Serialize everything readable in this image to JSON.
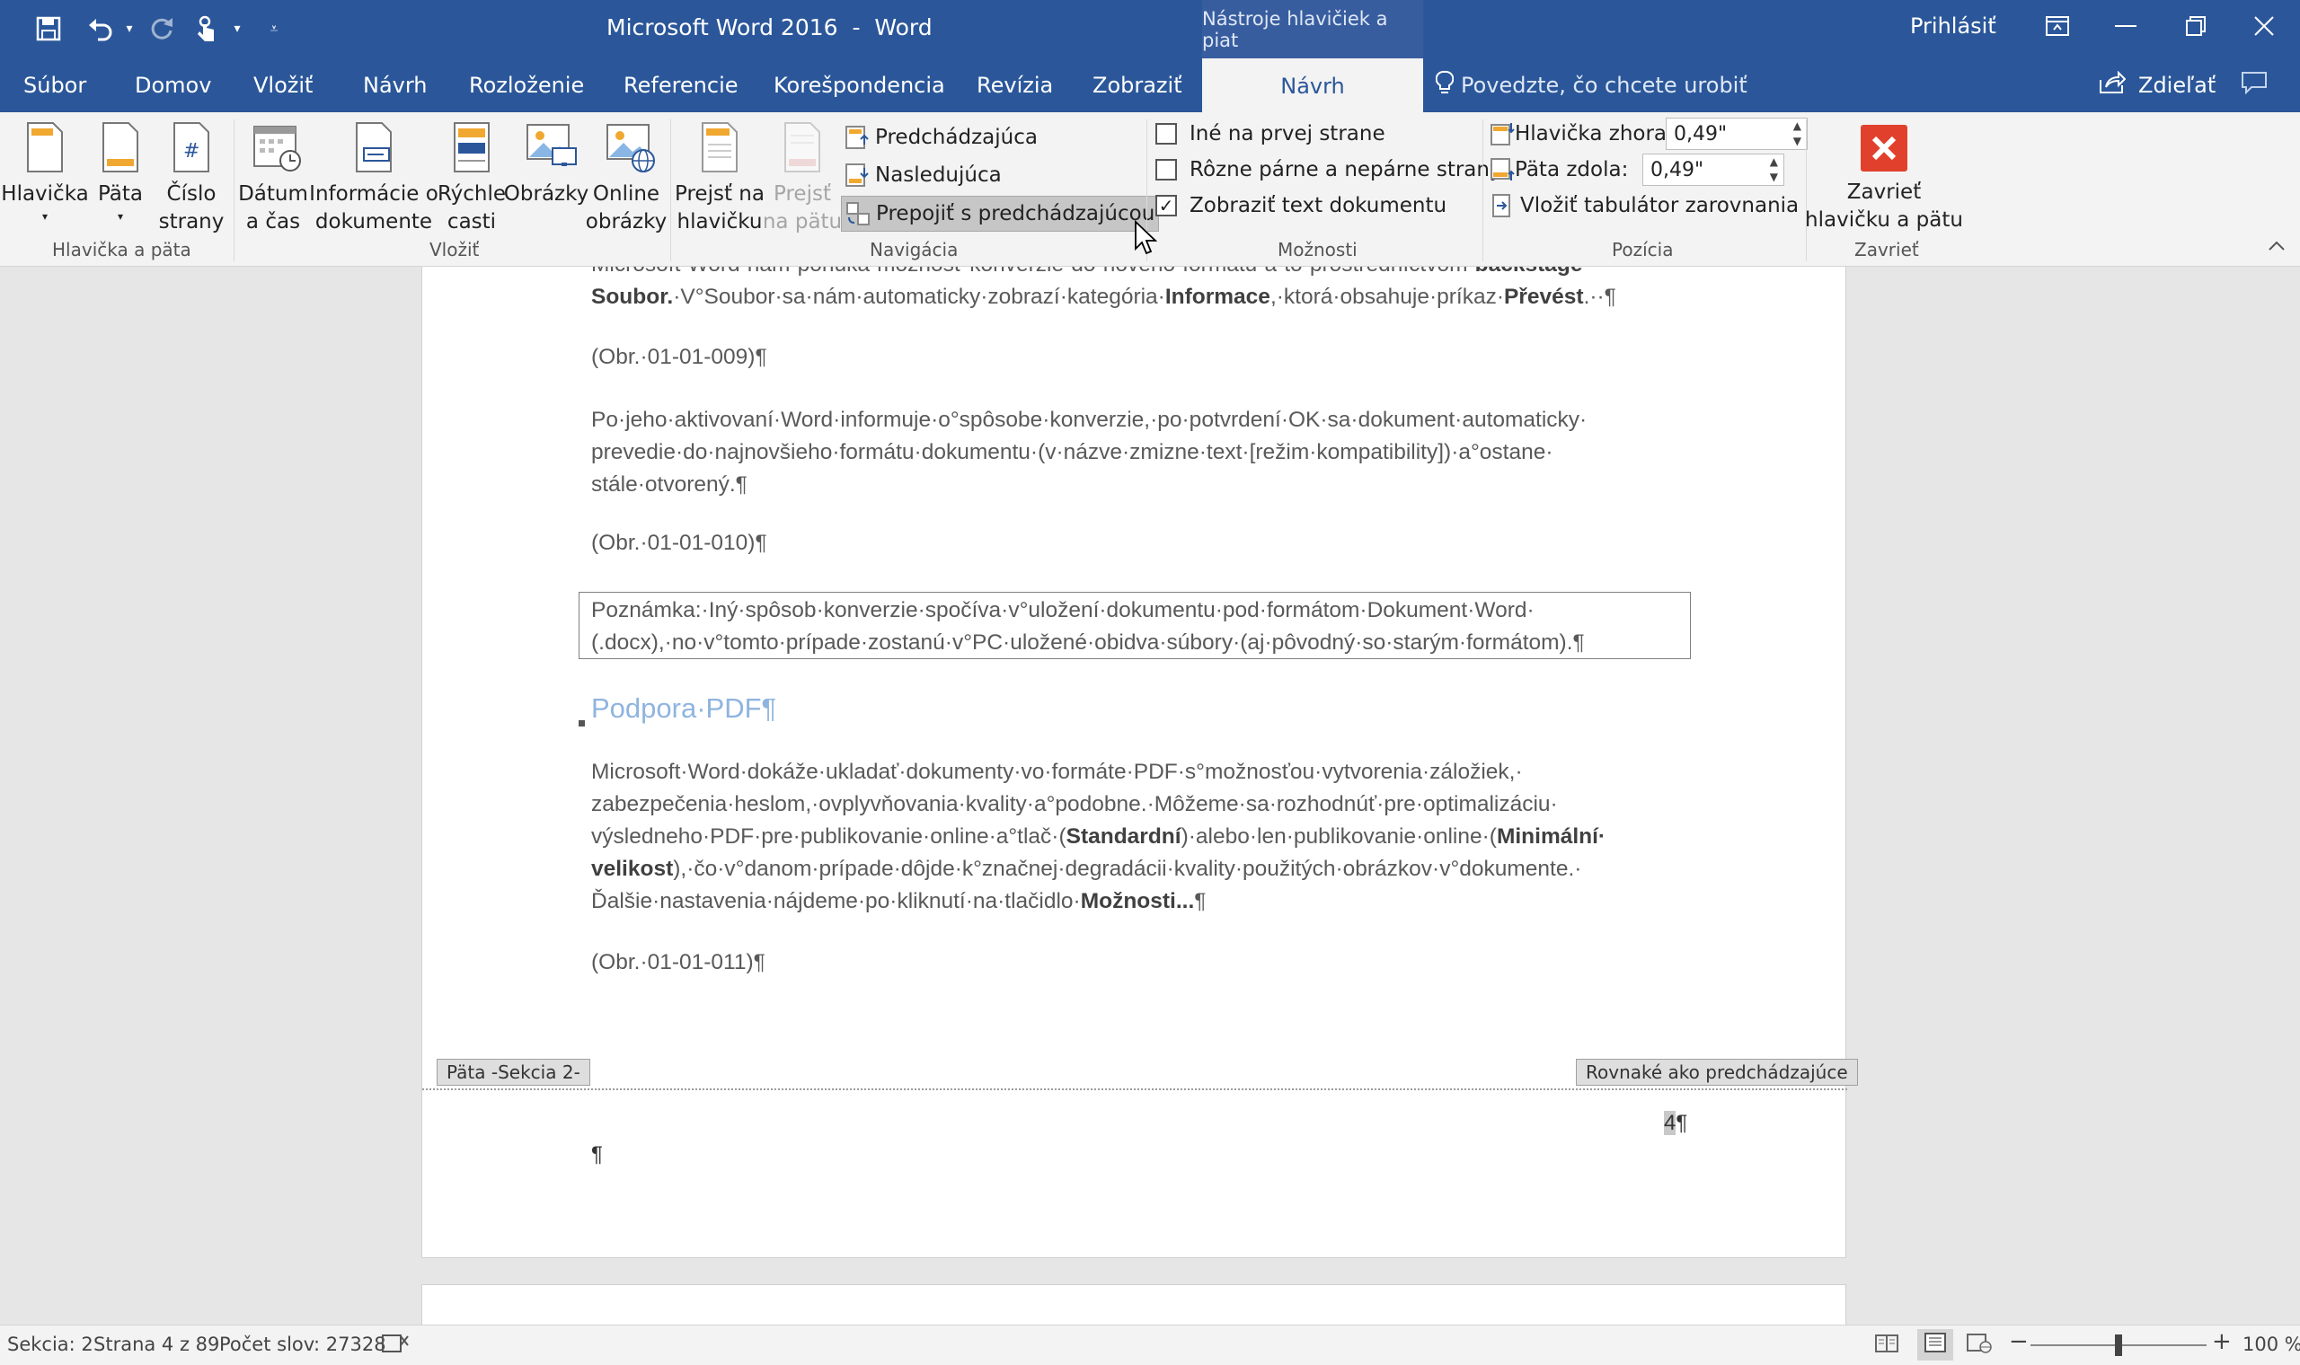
{
  "window": {
    "title": "Microsoft Word 2016  -  Word",
    "context_tools": "Nástroje hlavičiek a piat",
    "signin": "Prihlásiť"
  },
  "tabs": {
    "items": [
      "Súbor",
      "Domov",
      "Vložiť",
      "Návrh",
      "Rozloženie",
      "Referencie",
      "Korešpondencia",
      "Revízia",
      "Zobraziť"
    ],
    "active_context": "Návrh",
    "tell_me": "Povedzte, čo chcete urobiť",
    "share": "Zdieľať"
  },
  "ribbon": {
    "groups": {
      "header_footer": "Hlavička a päta",
      "insert": "Vložiť",
      "navigation": "Navigácia",
      "options": "Možnosti",
      "position": "Pozícia",
      "close": "Zavrieť"
    },
    "buttons": {
      "header": "Hlavička",
      "footer": "Päta",
      "page_number": "Číslo\nstrany",
      "date_time": "Dátum\na čas",
      "doc_info": "Informácie o\ndokumente",
      "quick_parts": "Rýchle\ncasti",
      "pictures": "Obrázky",
      "online_pictures": "Online\nobrázky",
      "goto_header": "Prejsť na\nhlavičku",
      "goto_footer": "Prejsť\nna pätu",
      "previous": "Predchádzajúca",
      "next": "Nasledujúca",
      "link_previous": "Prepojiť s predchádzajúcou",
      "close_hf": "Zavrieť\nhlavičku a pätu"
    },
    "options": {
      "different_first": "Iné na prvej strane",
      "odd_even": "Rôzne párne a nepárne strany",
      "show_doc_text": "Zobraziť text dokumentu",
      "show_doc_text_checked": true
    },
    "position": {
      "header_top_label": "Hlavička zhora:",
      "header_top_value": "0,49\"",
      "footer_bottom_label": "Päta zdola:",
      "footer_bottom_value": "0,49\"",
      "insert_tab": "Vložiť tabulátor zarovnania"
    }
  },
  "document": {
    "p0_line1_a": "Microsoft·Word·nám·ponúka·možnosť·konverzie·do·nového·formátu·a·to·prostredníctvom·",
    "p0_line1_b": "backstage·",
    "p0_line2_a": "Soubor.",
    "p0_line2_b": "·V°Soubor·sa·nám·automaticky·zobrazí·kategória·",
    "p0_line2_c": "Informace",
    "p0_line2_d": ",·ktorá·obsahuje·príkaz·",
    "p0_line2_e": "Převést",
    "p0_line2_f": ".··¶",
    "fig1": "(Obr.·01-01-009)¶",
    "p1_line1": "Po·jeho·aktivovaní·Word·informuje·o°spôsobe·konverzie,·po·potvrdení·OK·sa·dokument·automaticky·",
    "p1_line2": "prevedie·do·najnovšieho·formátu·dokumentu·(v·názve·zmizne·text·[režim·kompatibility])·a°ostane·",
    "p1_line3": "stále·otvorený.¶",
    "fig2": "(Obr.·01-01-010)¶",
    "note_line1": "Poznámka:·Iný·spôsob·konverzie·spočíva·v°uložení·dokumentu·pod·formátom·Dokument·Word·",
    "note_line2": "(.docx),·no·v°tomto·prípade·zostanú·v°PC·uložené·obidva·súbory·(aj·pôvodný·so·starým·formátom).¶",
    "heading": "Podpora·PDF¶",
    "p2_line1": "Microsoft·Word·dokáže·ukladať·dokumenty·vo·formáte·PDF·s°možnosťou·vytvorenia·záložiek,·",
    "p2_line2": "zabezpečenia·heslom,·ovplyvňovania·kvality·a°podobne.·Môžeme·sa·rozhodnúť·pre·optimalizáciu·",
    "p2_line3_a": "výsledneho·PDF·pre·publikovanie·online·a°tlač·(",
    "p2_line3_b": "Standardní",
    "p2_line3_c": ")·alebo·len·publikovanie·online·(",
    "p2_line3_d": "Minimální·",
    "p2_line4_a": "velikost",
    "p2_line4_b": "),·čo·v°danom·prípade·dôjde·k°značnej·degradácii·kvality·použitých·obrázkov·v°dokumente.·",
    "p2_line5_a": "Ďalšie·nastavenia·nájdeme·po·kliknutí·na·tlačidlo·",
    "p2_line5_b": "Možnosti...",
    "p2_line5_c": "¶",
    "fig3": "(Obr.·01-01-011)¶",
    "footer_tag": "Päta -Sekcia 2-",
    "same_as_prev": "Rovnaké ako predchádzajúce",
    "page_num_digit": "4",
    "page_num_mark": "¶",
    "pilcrow": "¶"
  },
  "status": {
    "section": "Sekcia: 2",
    "page": "Strana 4 z 89",
    "words": "Počet slov: 27328",
    "zoom": "100 %",
    "zoom_level": 1.0
  },
  "colors": {
    "word_blue": "#2b579a",
    "ribbon_bg": "#f3f3f3",
    "heading": "#8fb4df",
    "close_red": "#e1412c"
  }
}
